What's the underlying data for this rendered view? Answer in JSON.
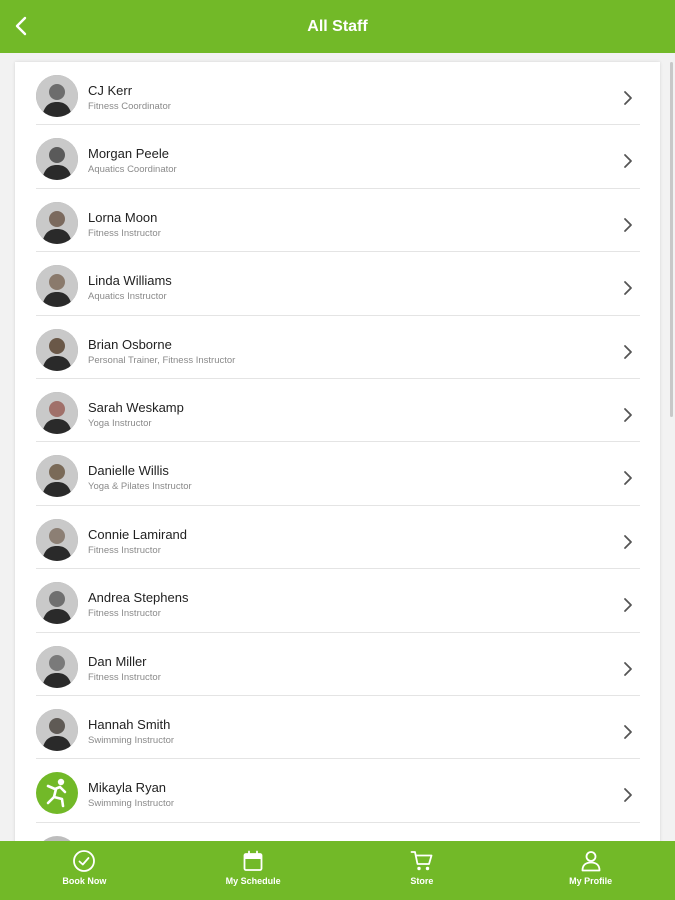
{
  "header": {
    "title": "All Staff"
  },
  "staff": [
    {
      "name": "CJ Kerr",
      "role": "Fitness Coordinator",
      "avatar": "photo"
    },
    {
      "name": "Morgan Peele",
      "role": "Aquatics Coordinator",
      "avatar": "photo"
    },
    {
      "name": "Lorna Moon",
      "role": "Fitness Instructor",
      "avatar": "photo"
    },
    {
      "name": "Linda Williams",
      "role": "Aquatics Instructor",
      "avatar": "photo"
    },
    {
      "name": "Brian Osborne",
      "role": "Personal Trainer, Fitness Instructor",
      "avatar": "photo"
    },
    {
      "name": "Sarah Weskamp",
      "role": "Yoga Instructor",
      "avatar": "photo"
    },
    {
      "name": "Danielle Willis",
      "role": "Yoga & Pilates Instructor",
      "avatar": "photo"
    },
    {
      "name": "Connie Lamirand",
      "role": "Fitness Instructor",
      "avatar": "photo"
    },
    {
      "name": "Andrea Stephens",
      "role": "Fitness Instructor",
      "avatar": "photo"
    },
    {
      "name": "Dan Miller",
      "role": "Fitness Instructor",
      "avatar": "photo"
    },
    {
      "name": "Hannah Smith",
      "role": "Swimming Instructor",
      "avatar": "photo"
    },
    {
      "name": "Mikayla Ryan",
      "role": "Swimming Instructor",
      "avatar": "logo"
    }
  ],
  "nav": [
    {
      "label": "Book Now",
      "icon": "check-circle-icon"
    },
    {
      "label": "My Schedule",
      "icon": "calendar-icon"
    },
    {
      "label": "Store",
      "icon": "cart-icon"
    },
    {
      "label": "My Profile",
      "icon": "person-icon"
    }
  ],
  "colors": {
    "brand": "#72b928",
    "background": "#f2f2f2",
    "card": "#ffffff"
  }
}
